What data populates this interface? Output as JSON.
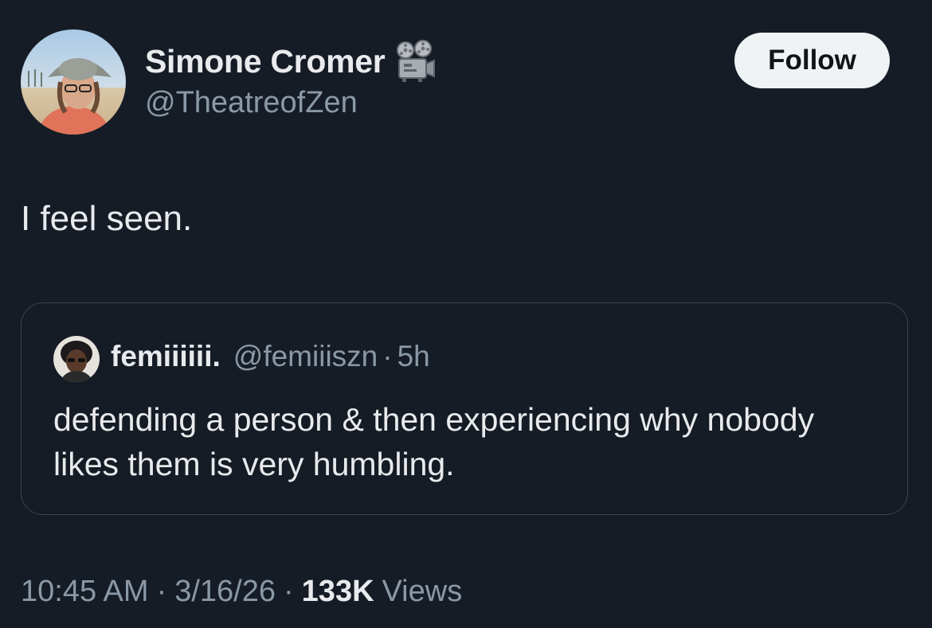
{
  "author": {
    "display_name": "Simone Cromer",
    "handle": "@TheatreofZen",
    "badge_icon": "film-projector-icon"
  },
  "follow_button": {
    "label": "Follow"
  },
  "tweet": {
    "text": "I feel seen."
  },
  "quoted_tweet": {
    "display_name": "femiiiiii.",
    "handle": "@femiiiszn",
    "separator": "·",
    "time": "5h",
    "text": "defending a person & then experiencing why nobody likes them is very humbling."
  },
  "meta": {
    "time": "10:45 AM",
    "date": "3/16/26",
    "separator": "·",
    "views_count": "133K",
    "views_label": "Views"
  },
  "colors": {
    "background": "#161c25",
    "primary_text": "#e8eaed",
    "secondary_text": "#8b98a5",
    "follow_button_bg": "#eff3f4",
    "border": "#38444d"
  }
}
